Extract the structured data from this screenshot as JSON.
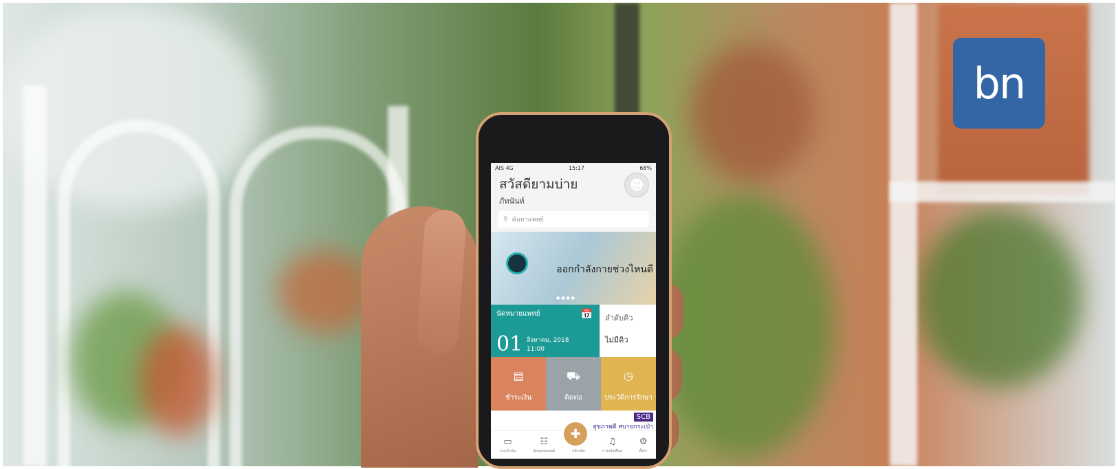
{
  "logo": {
    "text": "bn",
    "color": "#3465a4"
  },
  "phone": {
    "status_bar": {
      "carrier": "AIS 4G",
      "time": "15:17",
      "battery": "68%"
    },
    "greeting": {
      "title": "สวัสดียามบ่าย",
      "name": "ภัทนันท์"
    },
    "search": {
      "placeholder": "ค้นหาแพทย์",
      "icon": "search-icon"
    },
    "banner": {
      "caption": "ออกกำลังกายช่วงไหนดี"
    },
    "appointment": {
      "title": "นัดหมายแพทย์",
      "day": "01",
      "date": "สิงหาคม, 2018",
      "time": "11:00"
    },
    "queue": {
      "title": "ลำดับคิว",
      "status": "ไม่มีคิว"
    },
    "tiles": [
      {
        "label": "ชำระเงิน",
        "icon": "card-icon",
        "color": "#d9845e"
      },
      {
        "label": "ติดต่อ",
        "icon": "ambulance-icon",
        "color": "#9aa3a8"
      },
      {
        "label": "ประวัติการรักษา",
        "icon": "clock-icon",
        "color": "#e0b451"
      }
    ],
    "ad": {
      "brand": "SCB",
      "text": "สุขภาพดี สบายกระเป๋า"
    },
    "tabbar": [
      {
        "label": "กระเป๋าเงิน",
        "icon": "wallet-icon"
      },
      {
        "label": "นัดหมายแพทย์",
        "icon": "document-icon"
      },
      {
        "label": "หน้าหลัก",
        "icon": "plus-icon"
      },
      {
        "label": "การแจ้งเตือน",
        "icon": "bell-icon"
      },
      {
        "label": "ตั้งค่า",
        "icon": "gear-icon"
      }
    ]
  }
}
